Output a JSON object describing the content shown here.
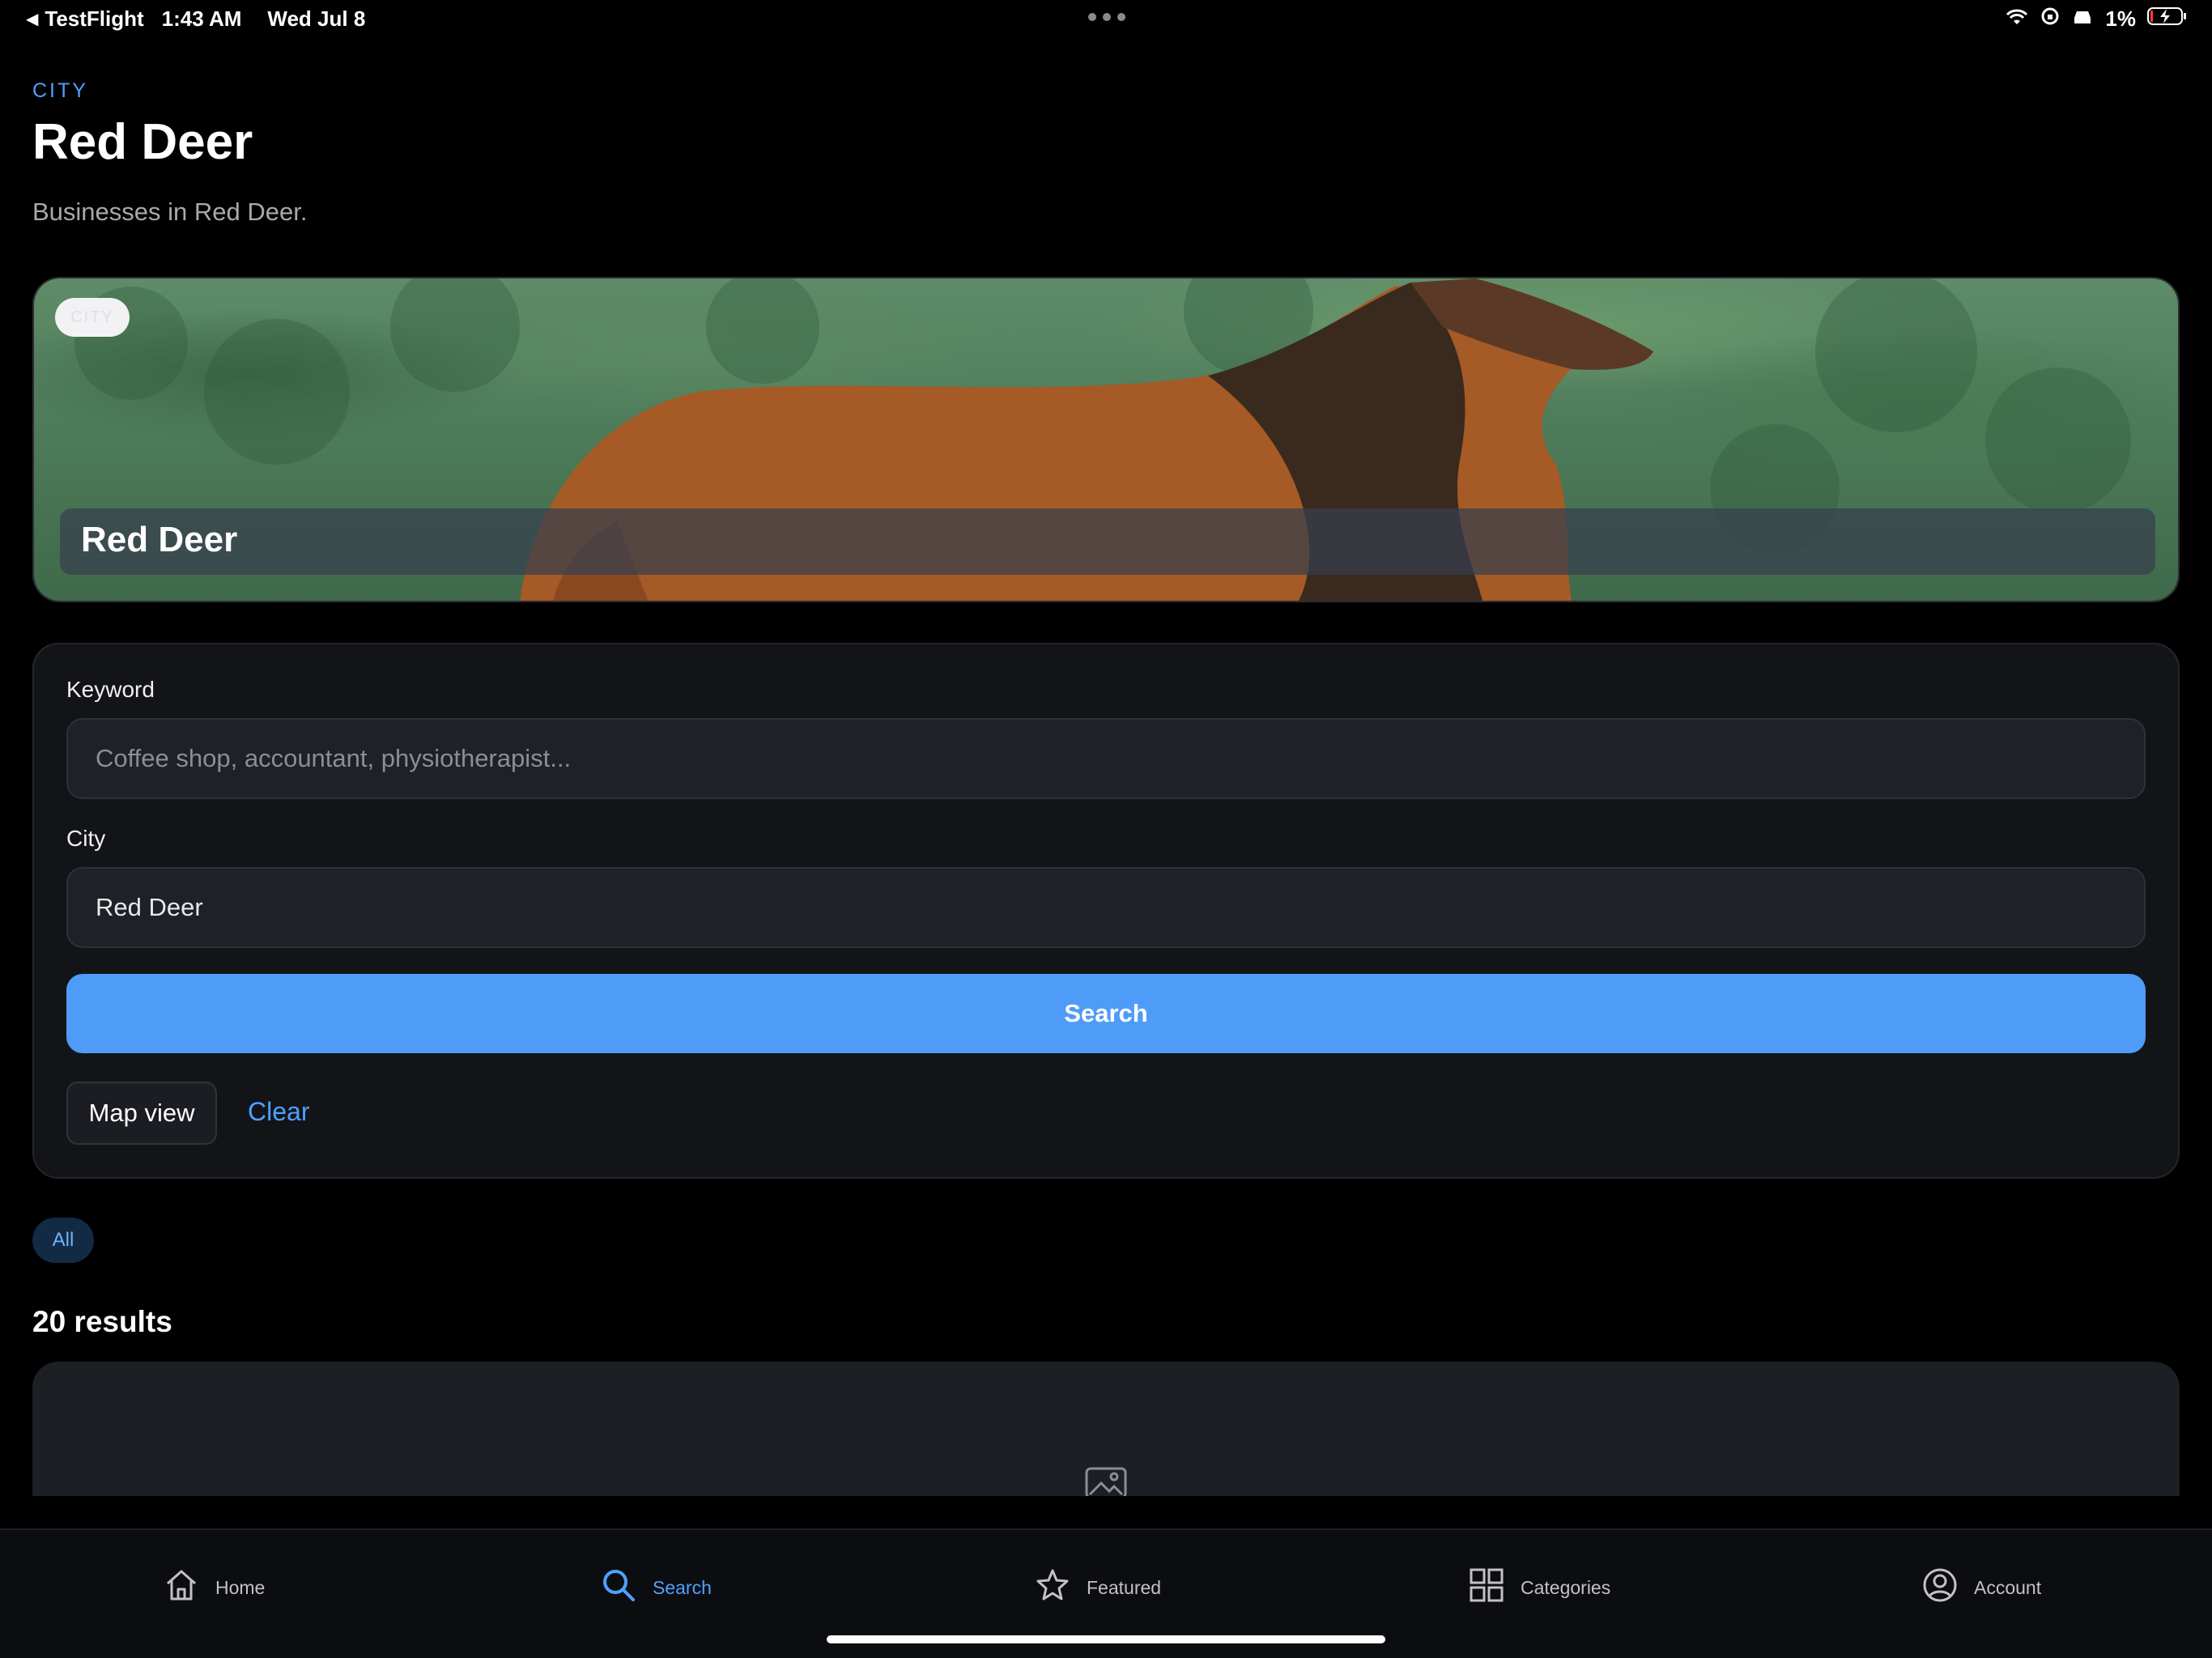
{
  "status_bar": {
    "back_app": "TestFlight",
    "time": "1:43 AM",
    "date": "Wed Jul 8",
    "battery": "1%"
  },
  "header": {
    "kicker": "CITY",
    "title": "Red Deer",
    "subtitle": "Businesses in Red Deer."
  },
  "hero": {
    "badge": "CITY",
    "title": "Red Deer"
  },
  "search_form": {
    "keyword_label": "Keyword",
    "keyword_placeholder": "Coffee shop, accountant, physiotherapist...",
    "city_label": "City",
    "city_value": "Red Deer",
    "search_button": "Search",
    "map_view_button": "Map view",
    "clear_link": "Clear"
  },
  "filters": {
    "chips": [
      {
        "label": "All",
        "active": true
      }
    ]
  },
  "results": {
    "count_text": "20 results"
  },
  "tab_bar": {
    "items": [
      {
        "label": "Home",
        "icon": "home-icon",
        "active": false
      },
      {
        "label": "Search",
        "icon": "search-icon",
        "active": true
      },
      {
        "label": "Featured",
        "icon": "star-icon",
        "active": false
      },
      {
        "label": "Categories",
        "icon": "grid-icon",
        "active": false
      },
      {
        "label": "Account",
        "icon": "user-circle-icon",
        "active": false
      }
    ]
  },
  "colors": {
    "accent": "#4e9cf7",
    "background": "#000000",
    "card": "#131418"
  }
}
